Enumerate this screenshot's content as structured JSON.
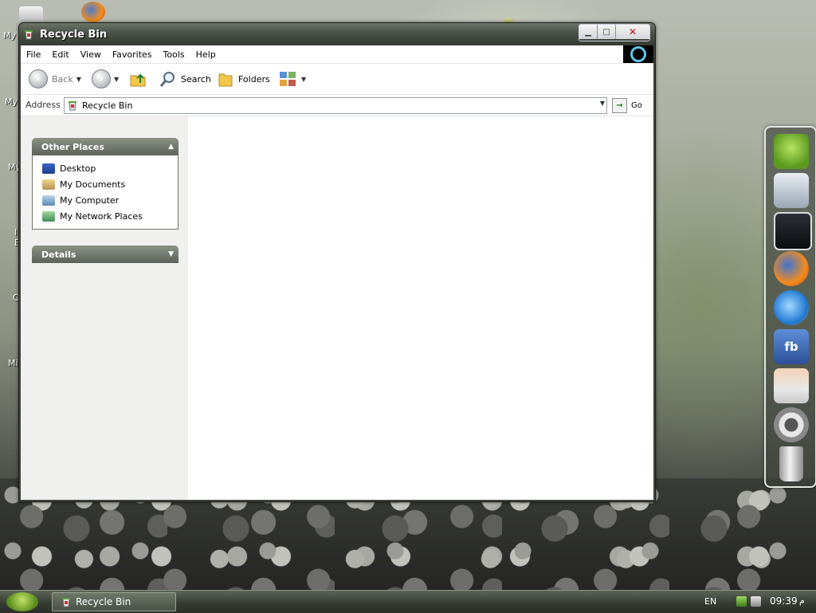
{
  "desktop": {
    "icon_labels": [
      "My I",
      "My",
      "My",
      "I",
      "E",
      "C",
      "Mi"
    ]
  },
  "window": {
    "title": "Recycle Bin",
    "controls": {
      "minimize": "▁",
      "maximize": "□",
      "close": "✕"
    }
  },
  "menu": [
    "File",
    "Edit",
    "View",
    "Favorites",
    "Tools",
    "Help"
  ],
  "toolbar": {
    "back": "Back",
    "search": "Search",
    "folders": "Folders"
  },
  "address": {
    "label": "Address",
    "value": "Recycle Bin",
    "go": "Go"
  },
  "taskpane": {
    "other_places": {
      "title": "Other Places",
      "items": [
        "Desktop",
        "My Documents",
        "My Computer",
        "My Network Places"
      ]
    },
    "details": {
      "title": "Details"
    }
  },
  "dock": {
    "items": [
      "android-icon",
      "computer-icon",
      "tablet-icon",
      "firefox-icon",
      "internet-explorer-icon",
      "facebook-icon",
      "support-person-icon",
      "settings-gear-icon",
      "trash-can-icon"
    ],
    "facebook_text": "fb"
  },
  "taskbar": {
    "task_label": "Recycle Bin",
    "lang": "EN",
    "time": "09:39",
    "ampm": "م"
  },
  "colors": {
    "titlebar": "#4a5146",
    "panel_header": "#6b7266",
    "taskbar": "#343a31"
  }
}
